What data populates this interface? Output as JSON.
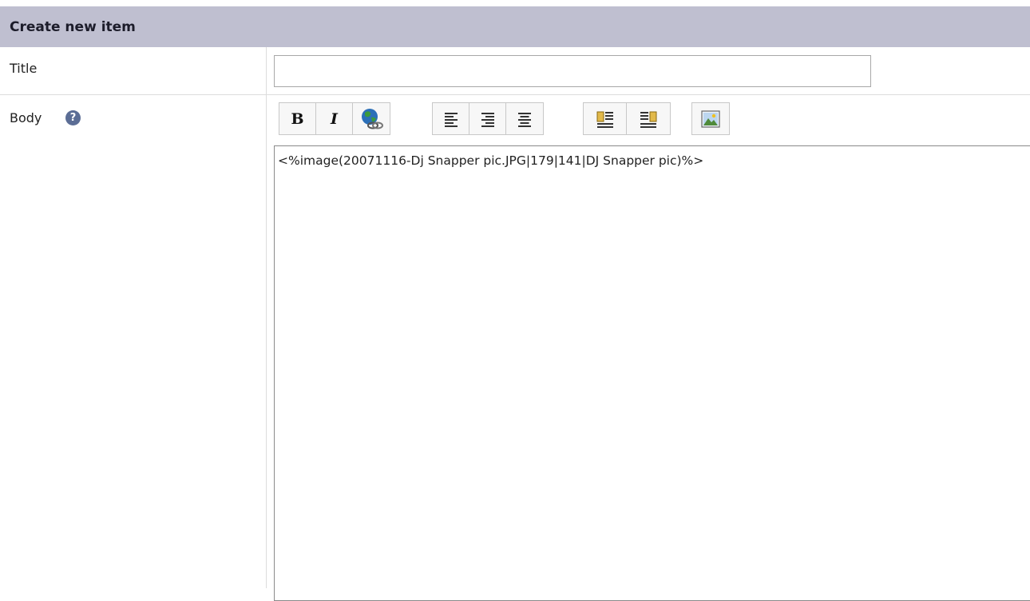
{
  "header": {
    "title": "Create new item"
  },
  "fields": {
    "title_label": "Title",
    "title_value": "",
    "body_label": "Body",
    "help_symbol": "?",
    "body_value": "<%image(20071116-Dj Snapper pic.JPG|179|141|DJ Snapper pic)%>"
  },
  "toolbar": {
    "bold_label": "B",
    "italic_label": "I",
    "icons": [
      "bold-icon",
      "italic-icon",
      "link-globe-icon",
      "align-left-icon",
      "align-right-icon",
      "align-center-icon",
      "float-left-icon",
      "float-right-icon",
      "insert-image-icon"
    ]
  },
  "colors": {
    "header_bg": "#bfbfd0",
    "help_icon": "#5b6d95",
    "divider": "#dcdcdc"
  }
}
